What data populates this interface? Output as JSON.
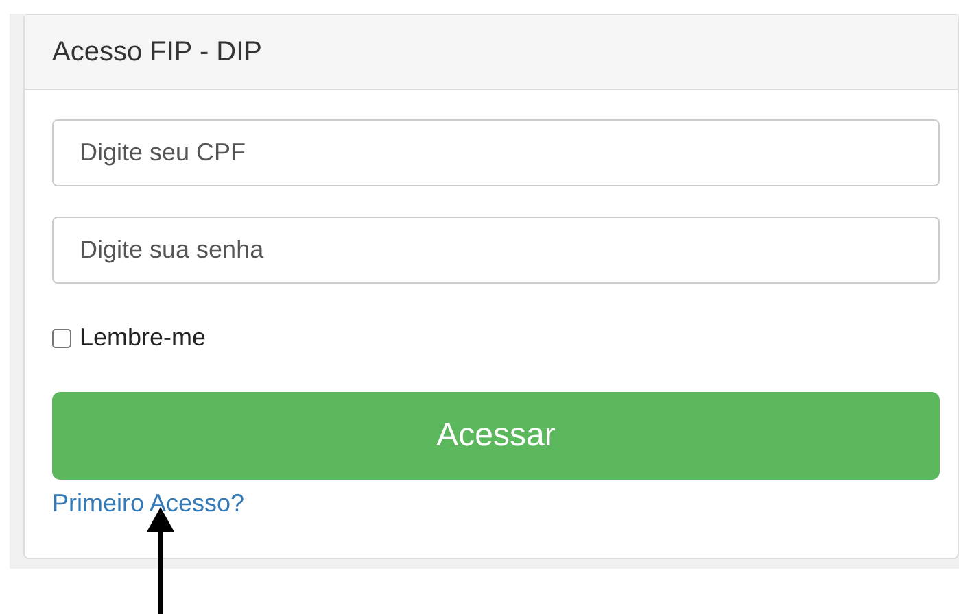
{
  "panel": {
    "title": "Acesso FIP - DIP"
  },
  "fields": [
    {
      "placeholder": "Digite seu CPF"
    },
    {
      "placeholder": "Digite sua senha"
    }
  ],
  "remember": {
    "label": "Lembre-me",
    "checked": false
  },
  "button": {
    "label": "Acessar"
  },
  "link": {
    "label": "Primeiro Acesso?"
  }
}
